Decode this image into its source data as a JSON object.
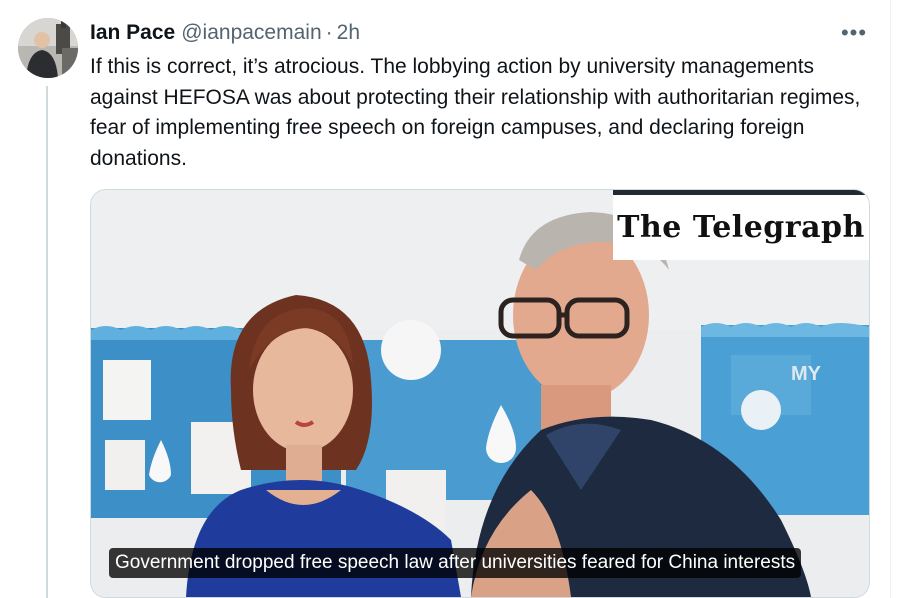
{
  "author": {
    "name": "Ian Pace",
    "handle": "@ianpacemain",
    "separator": "·",
    "time": "2h"
  },
  "more_label": "•••",
  "tweet": {
    "text": "If this is correct, it’s atrocious. The lobbying action by university managements against HEFOSA was about protecting their relationship with authoritarian regimes, fear of implementing free speech on foreign campuses, and declaring foreign donations."
  },
  "card": {
    "logo": "The Telegraph",
    "headline": "Government dropped free speech law after universities feared for China interests",
    "board_text": "MY"
  },
  "colors": {
    "text": "#0f1419",
    "secondary": "#536471",
    "border": "#cfd9de"
  }
}
